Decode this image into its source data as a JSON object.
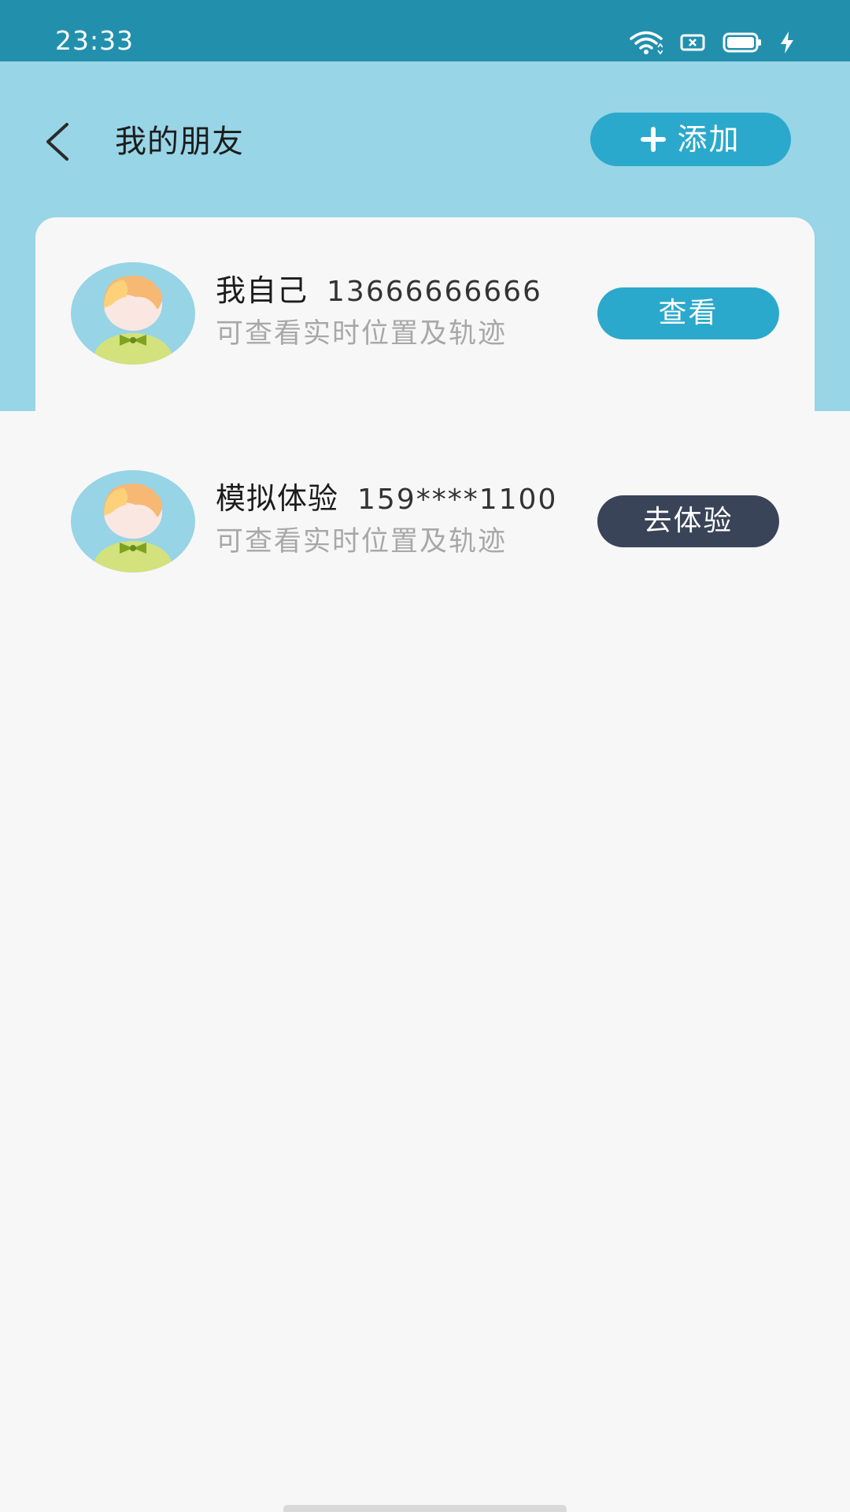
{
  "status_bar": {
    "time": "23:33",
    "icons": [
      "wifi-icon",
      "sim-card-icon",
      "battery-icon",
      "charging-bolt-icon"
    ]
  },
  "header": {
    "back_icon": "chevron-left-icon",
    "title": "我的朋友",
    "add_button": {
      "icon": "plus-icon",
      "label": "添加"
    }
  },
  "friends": [
    {
      "avatar": "boy-avatar-icon",
      "name": "我自己",
      "phone": "13666666666",
      "desc": "可查看实时位置及轨迹",
      "action_label": "查看",
      "action_color": "#2ba9cc"
    },
    {
      "avatar": "boy-avatar-icon",
      "name": "模拟体验",
      "phone": "159****1100",
      "desc": "可查看实时位置及轨迹",
      "action_label": "去体验",
      "action_color": "#3a4458"
    }
  ],
  "colors": {
    "status_bar": "#2290ad",
    "header_band": "#98d5e6",
    "accent": "#2ba9cc",
    "dark_button": "#3a4458",
    "background": "#f7f7f8"
  }
}
